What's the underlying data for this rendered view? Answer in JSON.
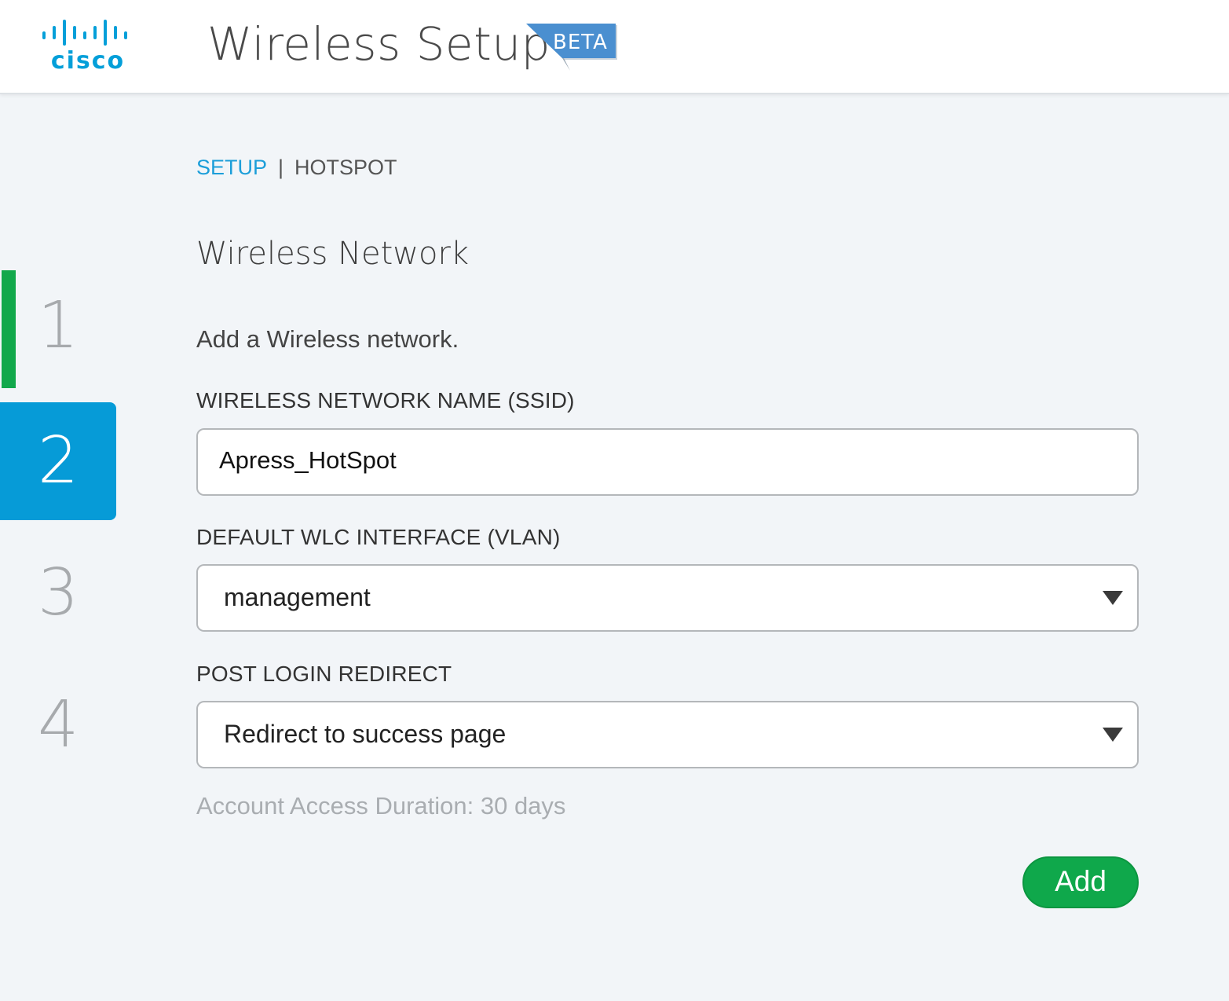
{
  "header": {
    "logo_text": "cisco",
    "app_title": "Wireless Setup",
    "badge": "BETA"
  },
  "steps": [
    "1",
    "2",
    "3",
    "4"
  ],
  "active_step": "2",
  "breadcrumb": {
    "setup": "SETUP",
    "separator": "|",
    "hotspot": "HOTSPOT"
  },
  "form": {
    "title": "Wireless Network",
    "intro": "Add a Wireless network.",
    "ssid_label": "WIRELESS NETWORK NAME (SSID)",
    "ssid_value": "Apress_HotSpot",
    "vlan_label": "DEFAULT WLC INTERFACE (VLAN)",
    "vlan_value": "management",
    "redirect_label": "POST LOGIN REDIRECT",
    "redirect_value": "Redirect to success page",
    "duration_note": "Account Access Duration: 30 days",
    "add_label": "Add"
  },
  "colors": {
    "brand_blue": "#049fd9",
    "active_step_bg": "#069bd7",
    "progress_green": "#12a84b",
    "add_button": "#0fa84b",
    "background": "#f2f5f8"
  },
  "icons": {
    "logo": "cisco-bridge-logo",
    "dropdown": "caret-down-icon"
  }
}
